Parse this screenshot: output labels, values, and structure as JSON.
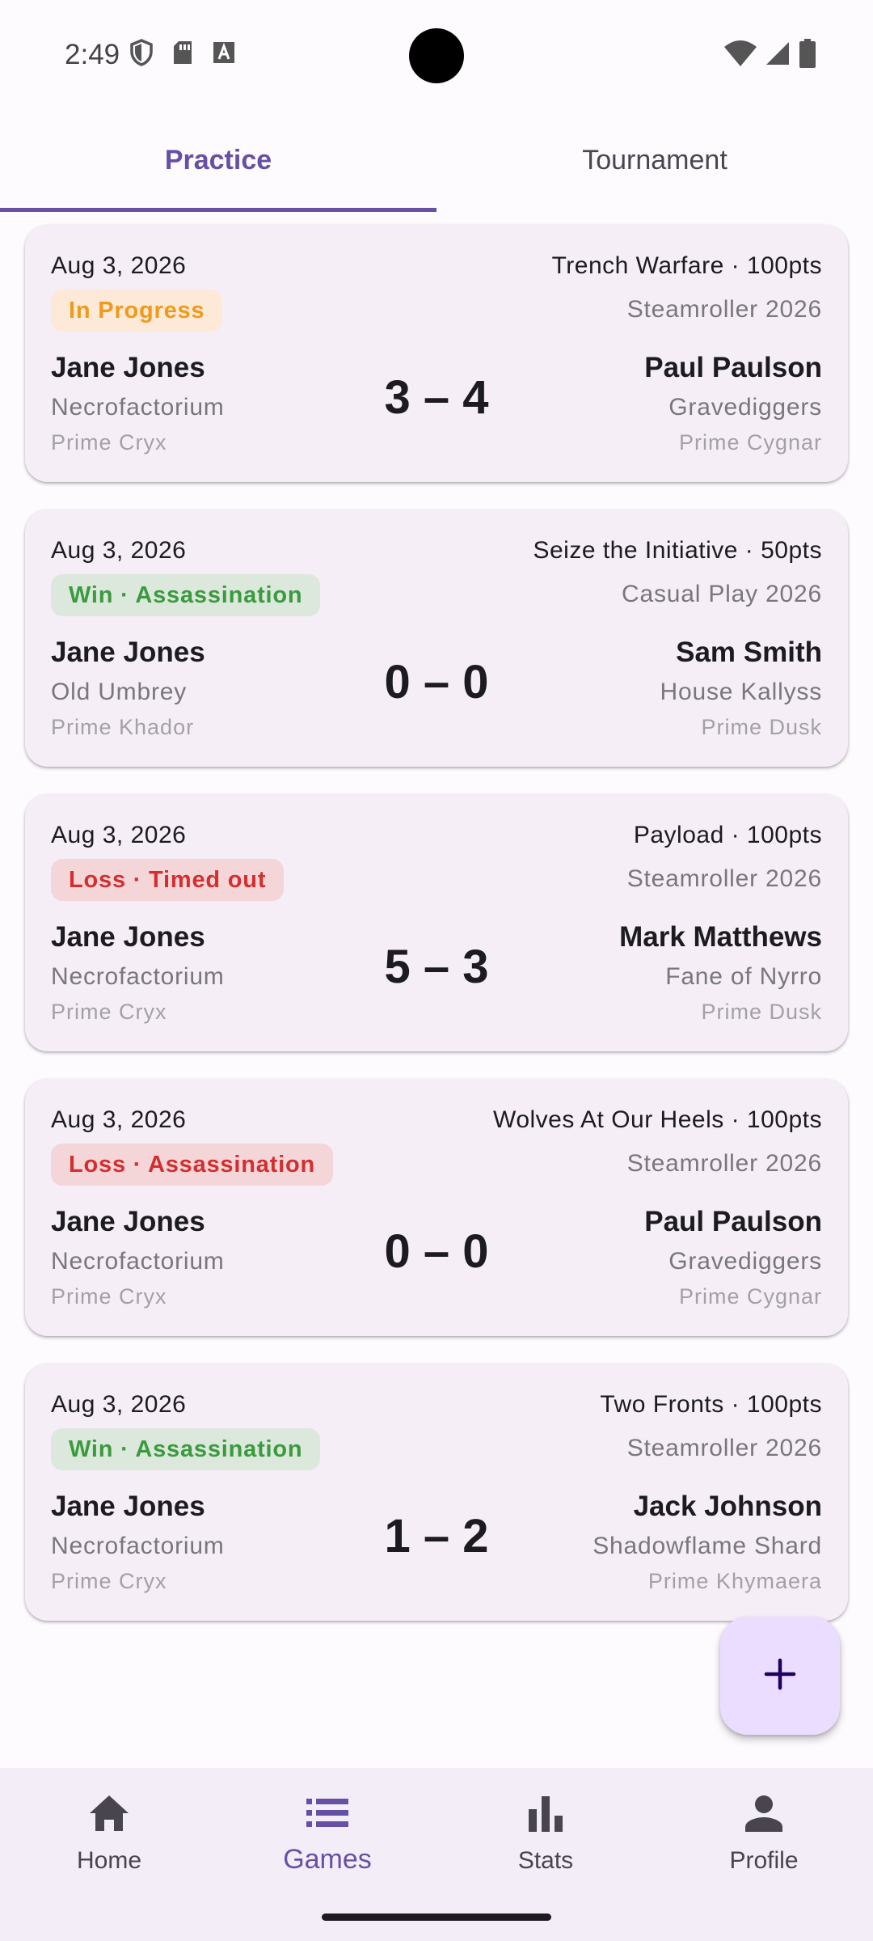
{
  "status_bar": {
    "time": "2:49"
  },
  "tabs": [
    {
      "label": "Practice",
      "active": true
    },
    {
      "label": "Tournament",
      "active": false
    }
  ],
  "games": [
    {
      "date": "Aug 3, 2026",
      "scenario": "Trench Warfare · 100pts",
      "status": "In Progress",
      "status_type": "progress",
      "event": "Steamroller 2026",
      "player1": {
        "name": "Jane Jones",
        "faction": "Necrofactorium",
        "caster": "Prime Cryx"
      },
      "score": "3 – 4",
      "player2": {
        "name": "Paul Paulson",
        "faction": "Gravediggers",
        "caster": "Prime Cygnar"
      }
    },
    {
      "date": "Aug 3, 2026",
      "scenario": "Seize the Initiative · 50pts",
      "status": "Win · Assassination",
      "status_type": "win",
      "event": "Casual Play 2026",
      "player1": {
        "name": "Jane Jones",
        "faction": "Old Umbrey",
        "caster": "Prime Khador"
      },
      "score": "0 – 0",
      "player2": {
        "name": "Sam Smith",
        "faction": "House Kallyss",
        "caster": "Prime Dusk"
      }
    },
    {
      "date": "Aug 3, 2026",
      "scenario": "Payload · 100pts",
      "status": "Loss · Timed out",
      "status_type": "loss",
      "event": "Steamroller 2026",
      "player1": {
        "name": "Jane Jones",
        "faction": "Necrofactorium",
        "caster": "Prime Cryx"
      },
      "score": "5 – 3",
      "player2": {
        "name": "Mark Matthews",
        "faction": "Fane of Nyrro",
        "caster": "Prime Dusk"
      }
    },
    {
      "date": "Aug 3, 2026",
      "scenario": "Wolves At Our Heels · 100pts",
      "status": "Loss · Assassination",
      "status_type": "loss",
      "event": "Steamroller 2026",
      "player1": {
        "name": "Jane Jones",
        "faction": "Necrofactorium",
        "caster": "Prime Cryx"
      },
      "score": "0 – 0",
      "player2": {
        "name": "Paul Paulson",
        "faction": "Gravediggers",
        "caster": "Prime Cygnar"
      }
    },
    {
      "date": "Aug 3, 2026",
      "scenario": "Two Fronts · 100pts",
      "status": "Win · Assassination",
      "status_type": "win",
      "event": "Steamroller 2026",
      "player1": {
        "name": "Jane Jones",
        "faction": "Necrofactorium",
        "caster": "Prime Cryx"
      },
      "score": "1 – 2",
      "player2": {
        "name": "Jack Johnson",
        "faction": "Shadowflame Shard",
        "caster": "Prime Khymaera"
      }
    }
  ],
  "fab": {
    "icon": "plus-icon"
  },
  "bottom_nav": [
    {
      "label": "Home",
      "icon": "home-icon",
      "active": false
    },
    {
      "label": "Games",
      "icon": "list-icon",
      "active": true
    },
    {
      "label": "Stats",
      "icon": "bar-chart-icon",
      "active": false
    },
    {
      "label": "Profile",
      "icon": "person-icon",
      "active": false
    }
  ],
  "colors": {
    "accent": "#6750a4",
    "card_background": "#f5eef6",
    "progress": "#f09a1a",
    "win": "#3a9b3e",
    "loss": "#d32f2f"
  }
}
